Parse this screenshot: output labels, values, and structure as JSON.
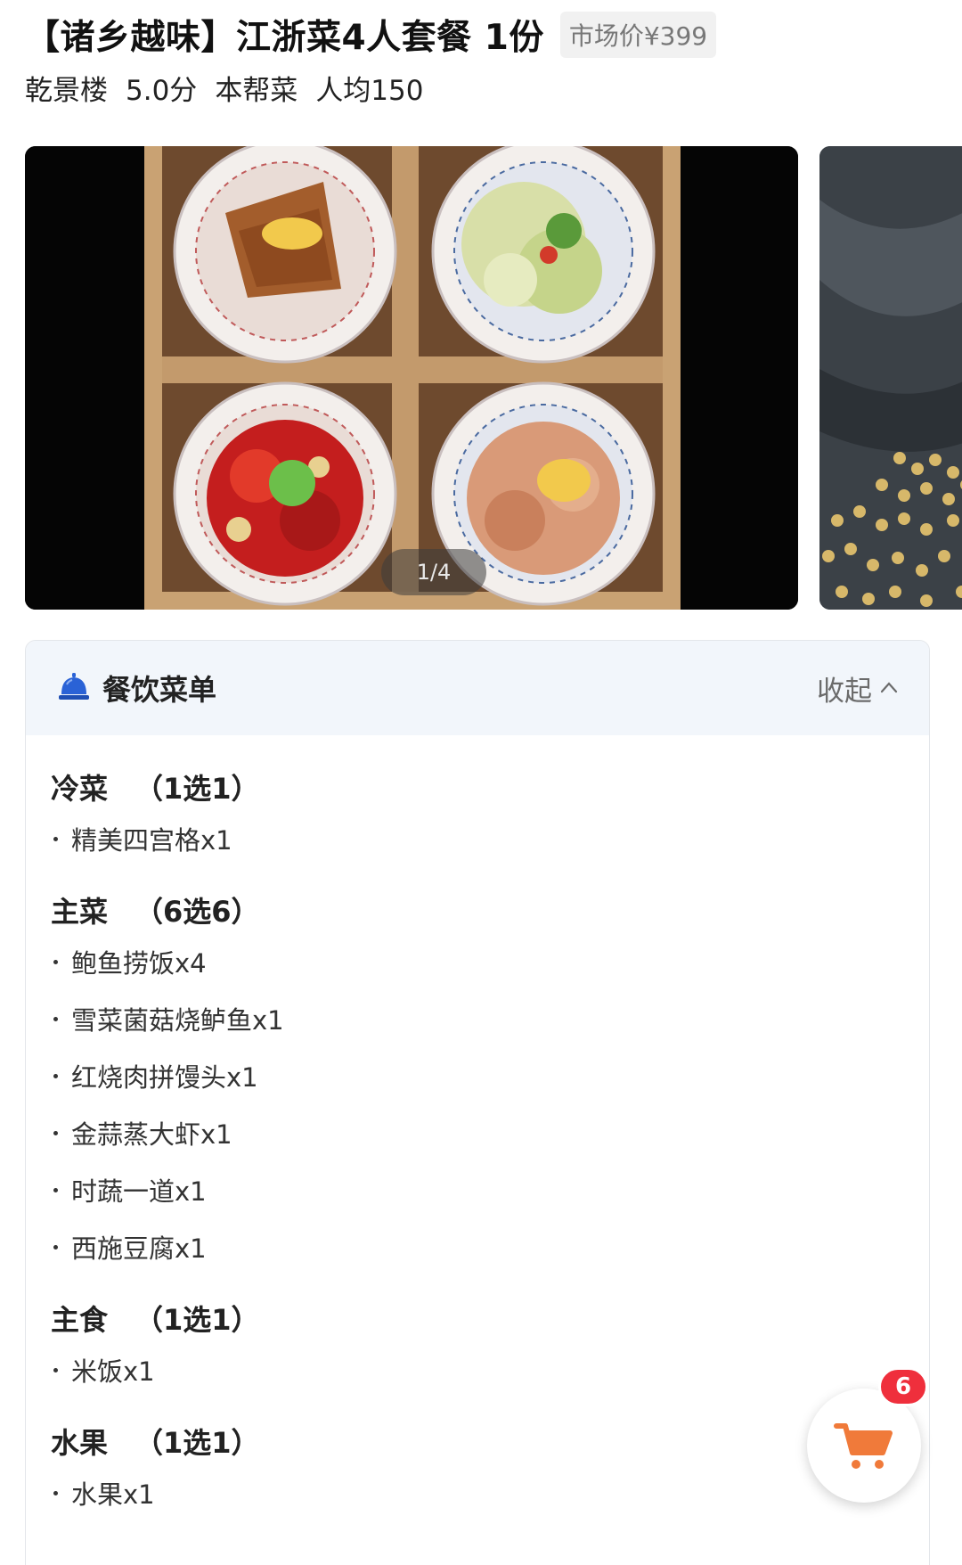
{
  "product": {
    "title": "【诸乡越味】江浙菜4人套餐 1份",
    "market_price": "市场价¥399"
  },
  "shop": {
    "name": "乾景楼",
    "rating": "5.0分",
    "cuisine": "本帮菜",
    "avg_price": "人均150"
  },
  "gallery": {
    "pager": "1/4"
  },
  "menu": {
    "title": "餐饮菜单",
    "collapse_label": "收起",
    "icon": "service-bell-icon",
    "sections": [
      {
        "name": "冷菜",
        "rule": "（1选1）",
        "items": [
          "精美四宫格x1"
        ]
      },
      {
        "name": "主菜",
        "rule": "（6选6）",
        "items": [
          "鲍鱼捞饭x4",
          "雪菜菌菇烧鲈鱼x1",
          "红烧肉拼馒头x1",
          "金蒜蒸大虾x1",
          "时蔬一道x1",
          "西施豆腐x1"
        ]
      },
      {
        "name": "主食",
        "rule": "（1选1）",
        "items": [
          "米饭x1"
        ]
      },
      {
        "name": "水果",
        "rule": "（1选1）",
        "items": [
          "水果x1"
        ]
      }
    ]
  },
  "cart": {
    "count": "6",
    "icon": "shopping-cart-icon"
  },
  "colors": {
    "accent": "#ef2f3c",
    "cart_orange": "#f07a3a",
    "bell_blue": "#2a62d6",
    "header_bg": "#f2f6fb"
  }
}
